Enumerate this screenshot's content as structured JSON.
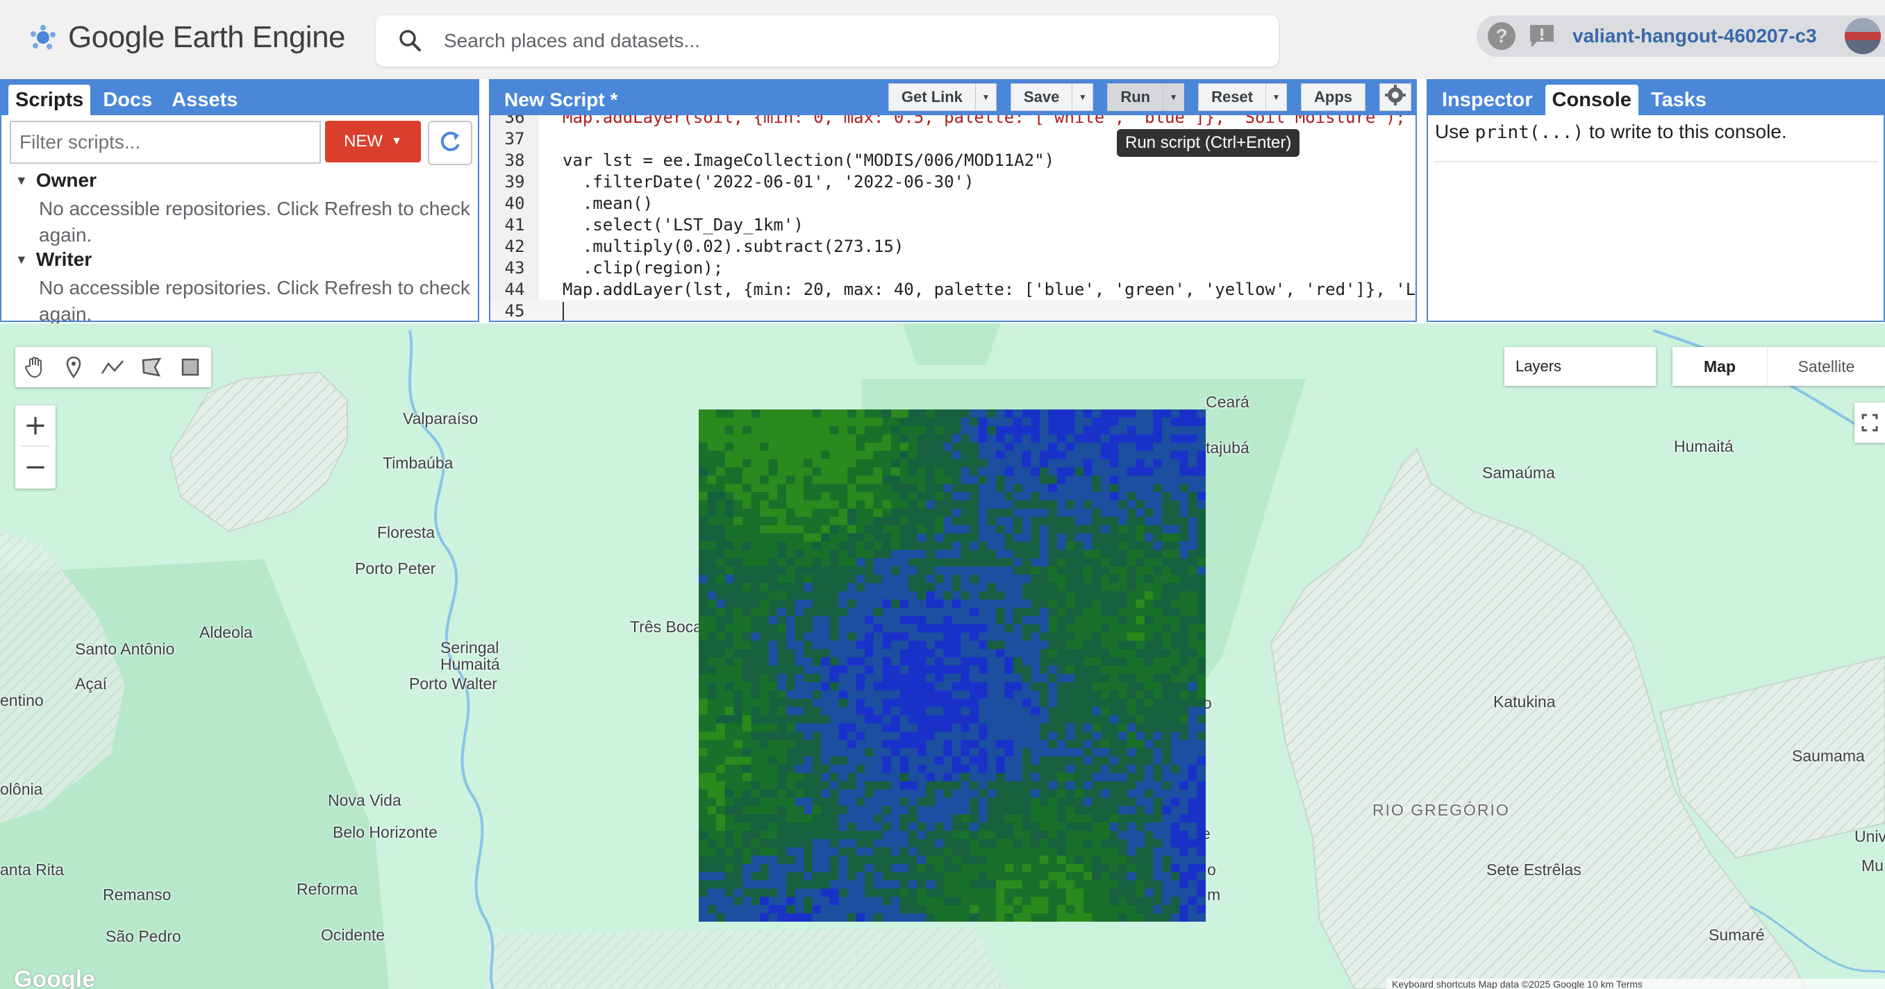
{
  "header": {
    "app_title": "Google Earth Engine",
    "search_placeholder": "Search places and datasets...",
    "project": "valiant-hangout-460207-c3"
  },
  "left_panel": {
    "tabs": [
      "Scripts",
      "Docs",
      "Assets"
    ],
    "active_tab": "Scripts",
    "filter_placeholder": "Filter scripts...",
    "new_label": "NEW",
    "sections": [
      {
        "title": "Owner",
        "note_line1": "No accessible repositories. Click Refresh to check",
        "note_line2": "again."
      },
      {
        "title": "Writer",
        "note_line1": "No accessible repositories. Click Refresh to check",
        "note_line2": "again."
      }
    ]
  },
  "editor": {
    "title": "New Script *",
    "buttons": {
      "get_link": "Get Link",
      "save": "Save",
      "run": "Run",
      "reset": "Reset",
      "apps": "Apps"
    },
    "tooltip": "Run script (Ctrl+Enter)",
    "lines": [
      {
        "n": "36",
        "text": "Map.addLayer(soil, {min: 0, max: 0.5, palette: ['white', 'blue']}, 'Soil Moisture');"
      },
      {
        "n": "37",
        "text": ""
      },
      {
        "n": "38",
        "text": "var lst = ee.ImageCollection(\"MODIS/006/MOD11A2\")"
      },
      {
        "n": "39",
        "text": "  .filterDate('2022-06-01', '2022-06-30')"
      },
      {
        "n": "40",
        "text": "  .mean()"
      },
      {
        "n": "41",
        "text": "  .select('LST_Day_1km')"
      },
      {
        "n": "42",
        "text": "  .multiply(0.02).subtract(273.15)"
      },
      {
        "n": "43",
        "text": "  .clip(region);"
      },
      {
        "n": "44",
        "text": "Map.addLayer(lst, {min: 20, max: 40, palette: ['blue', 'green', 'yellow', 'red']}, 'La"
      },
      {
        "n": "45",
        "text": ""
      }
    ]
  },
  "right_panel": {
    "tabs": [
      "Inspector",
      "Console",
      "Tasks"
    ],
    "active_tab": "Console",
    "console_pre": "Use ",
    "console_code": "print(...)",
    "console_post": " to write to this console."
  },
  "map": {
    "layers_label": "Layers",
    "map_type": "Map",
    "satellite_type": "Satellite",
    "zoom_in": "+",
    "zoom_out": "−",
    "google": "Google",
    "attribution": "Keyboard shortcuts    Map data ©2025 Google    10 km        Terms",
    "places": [
      "Valparaíso",
      "Timbaúba",
      "Floresta",
      "Porto Peter",
      "Aldeola",
      "Santo Antônio",
      "Açaí",
      "entino",
      "Seringal",
      "Humaitá",
      "Porto Walter",
      "Três Boca",
      "Ceará",
      "tajubá",
      "Humaitá",
      "Samaúma",
      "Katukina",
      "Saumama",
      "RIO GREGÓRIO",
      "Nova Vida",
      "Belo Horizonte",
      "olônia",
      "anta Rita",
      "Remanso",
      "Reforma",
      "São Pedro",
      "Ocidente",
      "Sete Estrêlas",
      "Sumaré",
      "Univ",
      "Mu",
      "e",
      "o",
      "m",
      "o"
    ],
    "raster_palette": [
      "#1a31c9",
      "#1c4fa0",
      "#17603f",
      "#19702a",
      "#2a8a1e"
    ]
  }
}
